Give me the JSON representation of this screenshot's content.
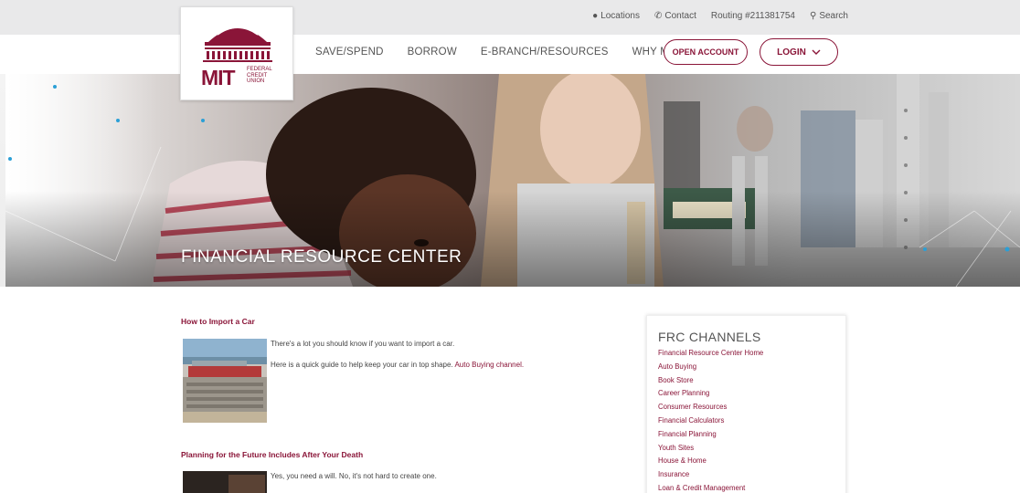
{
  "utility": {
    "locations": "Locations",
    "contact": "Contact",
    "routing": "Routing #211381754",
    "search": "Search"
  },
  "logo": {
    "mit": "MIT",
    "line1": "FEDERAL",
    "line2": "CREDIT",
    "line3": "UNION"
  },
  "nav": {
    "items": [
      "SAVE/SPEND",
      "BORROW",
      "E-BRANCH/RESOURCES",
      "WHY MIT FCU"
    ],
    "open_account": "OPEN ACCOUNT",
    "login": "LOGIN"
  },
  "hero": {
    "title": "FINANCIAL RESOURCE CENTER"
  },
  "articles": [
    {
      "title": "How to Import a Car",
      "line1": "There's a lot you should know if you want to import a car.",
      "line2_prefix": "Here is a quick guide to help keep your car in top shape. ",
      "line2_link": "Auto Buying channel."
    },
    {
      "title": "Planning for the Future Includes After Your Death",
      "line1": "Yes, you need a will. No, it's not hard to create one."
    }
  ],
  "frc": {
    "title": "FRC CHANNELS",
    "items": [
      "Financial Resource Center Home",
      "Auto Buying",
      "Book Store",
      "Career Planning",
      "Consumer Resources",
      "Financial Calculators",
      "Financial Planning",
      "Youth Sites",
      "House & Home",
      "Insurance",
      "Loan & Credit Management"
    ]
  },
  "colors": {
    "brand": "#8a1538",
    "accent_dot": "#2b9fd6",
    "utility_bg": "#e9e9ea"
  }
}
